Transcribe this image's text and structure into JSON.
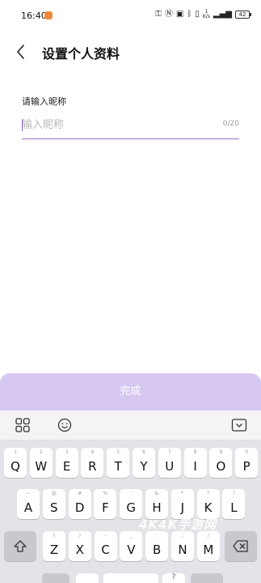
{
  "status_bar": {
    "time": "16:40",
    "speed_value": "1",
    "speed_unit": "K/s",
    "battery": "42"
  },
  "header": {
    "title": "设置个人资料"
  },
  "form": {
    "label": "请输入昵称",
    "placeholder": "输入昵称",
    "value": "",
    "counter": "0/20"
  },
  "done_button": {
    "label": "完成"
  },
  "keyboard_toolbar": {
    "icons": [
      "apps-grid-icon",
      "emoji-icon",
      "hide-keyboard-icon"
    ]
  },
  "keyboard": {
    "row1": [
      {
        "key": "Q",
        "sub": "1"
      },
      {
        "key": "W",
        "sub": "2"
      },
      {
        "key": "E",
        "sub": "3"
      },
      {
        "key": "R",
        "sub": "4"
      },
      {
        "key": "T",
        "sub": "5"
      },
      {
        "key": "Y",
        "sub": "6"
      },
      {
        "key": "U",
        "sub": "7"
      },
      {
        "key": "I",
        "sub": "8"
      },
      {
        "key": "O",
        "sub": "9"
      },
      {
        "key": "P",
        "sub": "0"
      }
    ],
    "row2": [
      {
        "key": "A",
        "sub": "~"
      },
      {
        "key": "S",
        "sub": "@"
      },
      {
        "key": "D",
        "sub": "#"
      },
      {
        "key": "F",
        "sub": "%"
      },
      {
        "key": "G",
        "sub": "'"
      },
      {
        "key": "H",
        "sub": "&"
      },
      {
        "key": "J",
        "sub": "*"
      },
      {
        "key": "K",
        "sub": "?"
      },
      {
        "key": "L",
        "sub": "!"
      }
    ],
    "row3": [
      {
        "key": "Z",
        "sub": "("
      },
      {
        "key": "X",
        "sub": ")"
      },
      {
        "key": "C",
        "sub": "-"
      },
      {
        "key": "V",
        "sub": "_"
      },
      {
        "key": "B",
        "sub": ":"
      },
      {
        "key": "N",
        "sub": ";"
      },
      {
        "key": "M",
        "sub": "/"
      }
    ],
    "shift_icon": "shift-icon",
    "backspace_icon": "backspace-icon",
    "bottom_row_hint": "?"
  },
  "watermark": "4K4K手游网"
}
